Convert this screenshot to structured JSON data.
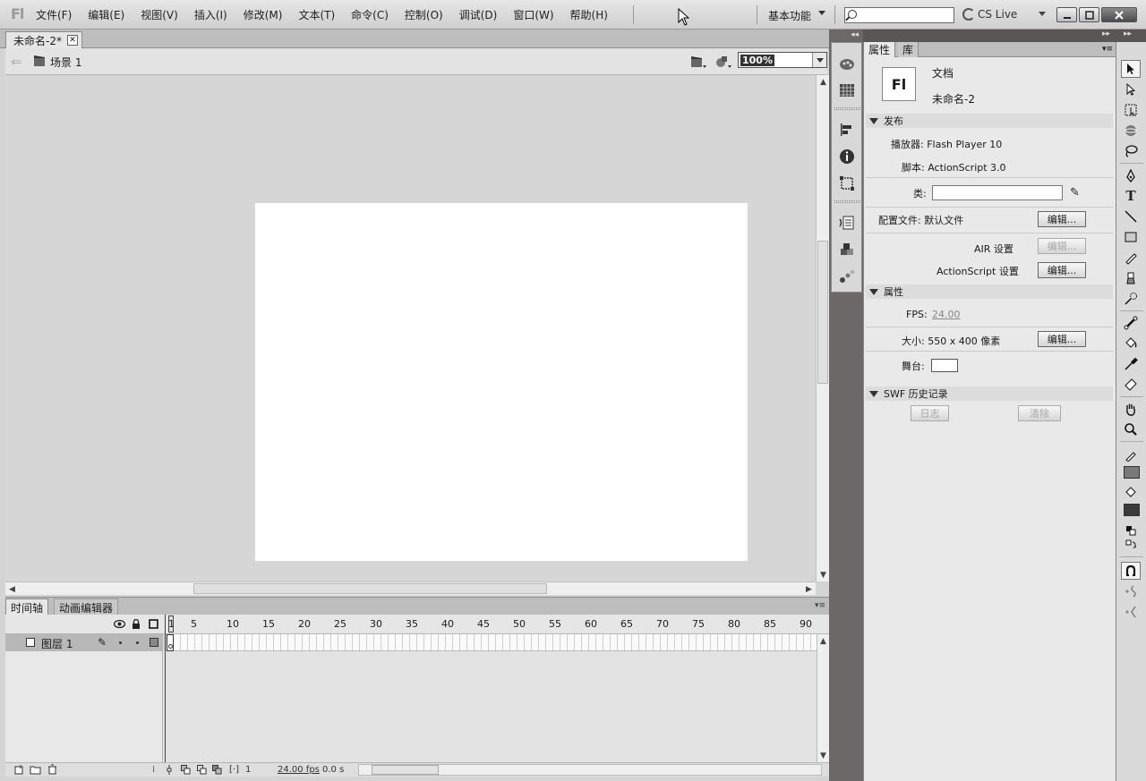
{
  "menubar": {
    "logo": "Fl",
    "items": [
      "文件(F)",
      "编辑(E)",
      "视图(V)",
      "插入(I)",
      "修改(M)",
      "文本(T)",
      "命令(C)",
      "控制(O)",
      "调试(D)",
      "窗口(W)",
      "帮助(H)"
    ],
    "workspace": "基本功能",
    "search_value": "",
    "cs_live": "CS Live"
  },
  "document": {
    "tab_label": "未命名-2*",
    "scene_label": "场景 1",
    "zoom": "100%"
  },
  "timeline": {
    "tabs": [
      "时间轴",
      "动画编辑器"
    ],
    "ruler": [
      "1",
      "5",
      "10",
      "15",
      "20",
      "25",
      "30",
      "35",
      "40",
      "45",
      "50",
      "55",
      "60",
      "65",
      "70",
      "75",
      "80",
      "85",
      "90"
    ],
    "layer_name": "图层 1",
    "footer": {
      "current_frame": "1",
      "fps": "24.00 fps",
      "time": "0.0 s"
    }
  },
  "properties": {
    "tabs": [
      "属性",
      "库"
    ],
    "doc_icon": "Fl",
    "doc_type": "文档",
    "doc_name": "未命名-2",
    "publish_header": "发布",
    "player": "播放器: Flash Player 10",
    "script": "脚本: ActionScript 3.0",
    "class_label": "类:",
    "class_value": "",
    "profile": "配置文件: 默认文件",
    "edit_label": "编辑...",
    "air_label": "AIR 设置",
    "as_label": "ActionScript 设置",
    "props_header": "属性",
    "fps_label": "FPS:",
    "fps_value": "24.00",
    "size": "大小: 550 x 400 像素",
    "stage_label": "舞台:",
    "stage_color": "#ffffff",
    "swf_header": "SWF 历史记录",
    "log_label": "日志",
    "clear_label": "清除"
  }
}
